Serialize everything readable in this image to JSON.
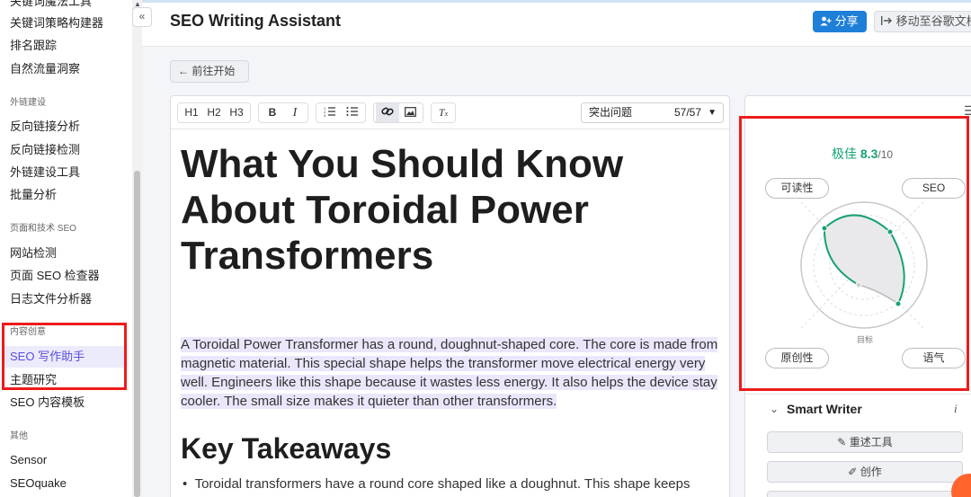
{
  "sidebar": {
    "top_items": [
      "关键词魔法工具",
      "关键词策略构建器",
      "排名跟踪",
      "自然流量洞察"
    ],
    "sections": [
      {
        "title": "外链建设",
        "items": [
          "反向链接分析",
          "反向链接检测",
          "外链建设工具",
          "批量分析"
        ]
      },
      {
        "title": "页面和技术 SEO",
        "items": [
          "网站检测",
          "页面 SEO 检查器",
          "日志文件分析器"
        ]
      },
      {
        "title": "内容创意",
        "items": [
          "SEO 写作助手",
          "主题研究",
          "SEO 内容模板"
        ]
      },
      {
        "title": "其他",
        "items": [
          "Sensor",
          "SEOquake"
        ]
      }
    ],
    "active_item": "SEO 写作助手"
  },
  "header": {
    "title": "SEO Writing Assistant",
    "share_label": "分享",
    "move_label": "移动至谷歌文档",
    "collapse_icon": "«"
  },
  "back_label": "前往开始",
  "toolbar": {
    "headings": [
      "H1",
      "H2",
      "H3"
    ],
    "bold": "B",
    "italic": "I",
    "issue_select_label": "突出问题",
    "issue_count": "57/57"
  },
  "document": {
    "title": "What You Should Know About Toroidal Power Transformers",
    "paragraph": "A Toroidal Power Transformer has a round, doughnut-shaped core. The core is made from magnetic material. This special shape helps the transformer move electrical energy very well. Engineers like this shape because it wastes less energy. It also helps the device stay cooler. The small size makes it quieter than other transformers.",
    "h2": "Key Takeaways",
    "bullet": "Toroidal transformers have a round core shaped like a doughnut. This shape keeps"
  },
  "score": {
    "label": "极佳",
    "value": "8.3",
    "max": "/10",
    "axes": [
      "可读性",
      "SEO",
      "原创性",
      "语气"
    ],
    "target_label": "目标",
    "accent_color": "#17a276"
  },
  "smart_writer": {
    "title": "Smart Writer",
    "info": "i",
    "rephrase_label": "重述工具",
    "compose_label": "创作"
  }
}
